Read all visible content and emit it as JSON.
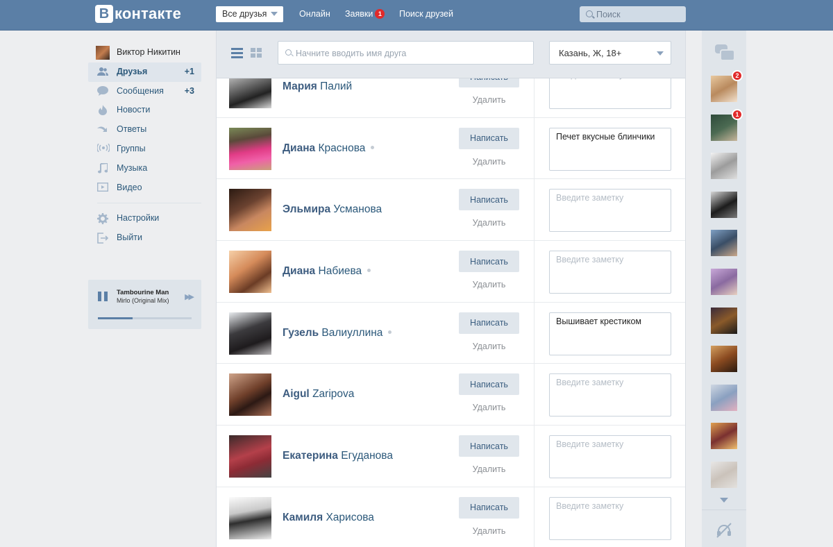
{
  "header": {
    "logo_letter": "В",
    "logo_text": "контакте",
    "filter_dropdown": "Все друзья",
    "nav": [
      {
        "label": "Онлайн"
      },
      {
        "label": "Заявки",
        "badge": "1"
      },
      {
        "label": "Поиск друзей"
      }
    ],
    "search_placeholder": "Поиск"
  },
  "sidebar": {
    "profile_name": "Виктор Никитин",
    "items": [
      {
        "label": "Друзья",
        "count": "+1",
        "icon": "friends-icon",
        "active": true
      },
      {
        "label": "Сообщения",
        "count": "+3",
        "icon": "messages-icon"
      },
      {
        "label": "Новости",
        "icon": "news-icon"
      },
      {
        "label": "Ответы",
        "icon": "replies-icon"
      },
      {
        "label": "Группы",
        "icon": "groups-icon"
      },
      {
        "label": "Музыка",
        "icon": "music-icon"
      },
      {
        "label": "Видео",
        "icon": "video-icon"
      }
    ],
    "secondary": [
      {
        "label": "Настройки",
        "icon": "gear-icon"
      },
      {
        "label": "Выйти",
        "icon": "logout-icon"
      }
    ]
  },
  "player": {
    "title": "Tambourine Man",
    "subtitle": "Mirlo (Original Mix)",
    "progress": 0.37
  },
  "main": {
    "search_placeholder": "Начните вводить имя друга",
    "city_filter": "Казань, Ж, 18+",
    "write_label": "Написать",
    "delete_label": "Удалить",
    "note_placeholder": "Введите заметку",
    "friends": [
      {
        "first": "Мария",
        "last": "Палий",
        "online": false,
        "note": ""
      },
      {
        "first": "Диана",
        "last": "Краснова",
        "online": true,
        "note": "Печет вкусные блинчики"
      },
      {
        "first": "Эльмира",
        "last": "Усманова",
        "online": false,
        "note": ""
      },
      {
        "first": "Диана",
        "last": "Набиева",
        "online": true,
        "note": ""
      },
      {
        "first": "Гузель",
        "last": "Валиуллина",
        "online": true,
        "note": "Вышивает крестиком"
      },
      {
        "first": "Aigul",
        "last": "Zaripova",
        "online": false,
        "note": ""
      },
      {
        "first": "Екатерина",
        "last": "Егуданова",
        "online": false,
        "note": ""
      },
      {
        "first": "Камиля",
        "last": "Харисова",
        "online": false,
        "note": ""
      }
    ]
  },
  "rail": {
    "badges": [
      "2",
      "1"
    ]
  },
  "colors": {
    "header_bg": "#5b7fa6",
    "link": "#2b587a",
    "badge": "#e12a2a"
  }
}
